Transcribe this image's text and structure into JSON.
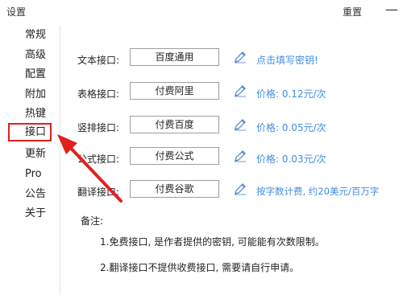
{
  "window": {
    "title": "设置",
    "reset_label": "重置",
    "close_glyph": "—"
  },
  "sidebar": {
    "items": [
      {
        "label": "常规"
      },
      {
        "label": "高级"
      },
      {
        "label": "配置"
      },
      {
        "label": "附加"
      },
      {
        "label": "热键"
      },
      {
        "label": "接口",
        "active": true
      },
      {
        "label": "更新"
      },
      {
        "label": "Pro"
      },
      {
        "label": "公告"
      },
      {
        "label": "关于"
      }
    ]
  },
  "interfaces": [
    {
      "label": "文本接口:",
      "value": "百度通用",
      "note": "点击填写密钥!"
    },
    {
      "label": "表格接口:",
      "value": "付费阿里",
      "note": "价格: 0.12元/次"
    },
    {
      "label": "竖排接口:",
      "value": "付费百度",
      "note": "价格: 0.05元/次"
    },
    {
      "label": "公式接口:",
      "value": "付费公式",
      "note": "价格: 0.03元/次"
    },
    {
      "label": "翻译接口:",
      "value": "付费谷歌",
      "note": "按字数计费, 约20美元/百万字"
    }
  ],
  "notes": {
    "title": "备注:",
    "lines": [
      "1.免费接口, 是作者提供的密钥, 可能能有次数限制。",
      "2.翻译接口不提供收费接口, 需要请自行申请。"
    ]
  },
  "colors": {
    "accent": "#3f8ee0",
    "highlight": "#e0211d",
    "pencil": "#4a7fc1"
  }
}
